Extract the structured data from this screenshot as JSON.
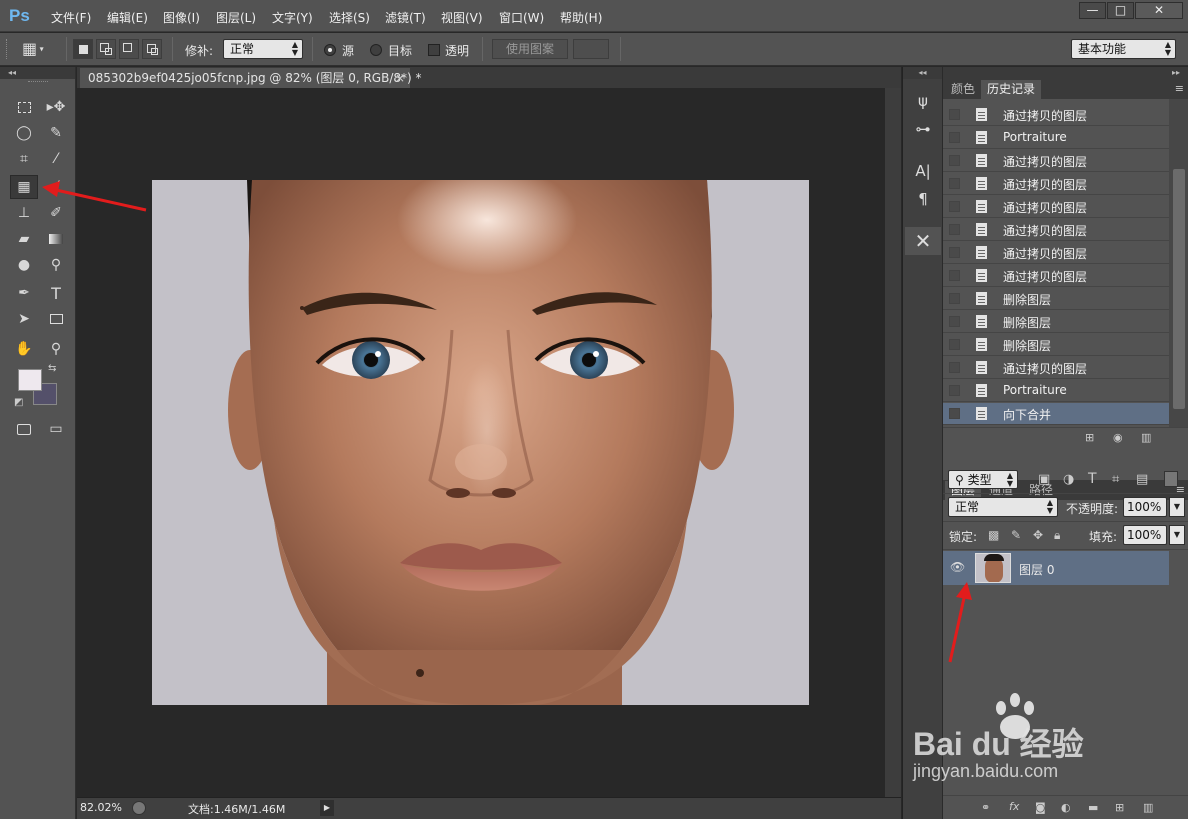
{
  "app": {
    "logo": "Ps"
  },
  "menu": [
    "文件(F)",
    "编辑(E)",
    "图像(I)",
    "图层(L)",
    "文字(Y)",
    "选择(S)",
    "滤镜(T)",
    "视图(V)",
    "窗口(W)",
    "帮助(H)"
  ],
  "window_controls": {
    "minimize": "—",
    "maximize": "□",
    "close": "✕"
  },
  "options": {
    "patch_label": "修补:",
    "patch_mode": "正常",
    "source_label": "源",
    "target_label": "目标",
    "transparent_label": "透明",
    "use_pattern": "使用图案",
    "workspace": "基本功能",
    "source_selected": true
  },
  "document": {
    "tab_title": "085302b9ef0425jo05fcnp.jpg @ 82% (图层 0, RGB/8*) *",
    "tab_close": "×",
    "zoom": "82.02%",
    "doc_size": "文档:1.46M/1.46M"
  },
  "colors": {
    "foreground": "#eee8ee",
    "background": "#54506a",
    "selection": "#5f6f85"
  },
  "history_panel": {
    "tabs": [
      "颜色",
      "历史记录"
    ],
    "active_tab": "历史记录",
    "items": [
      "通过拷贝的图层",
      "Portraiture",
      "通过拷贝的图层",
      "通过拷贝的图层",
      "通过拷贝的图层",
      "通过拷贝的图层",
      "通过拷贝的图层",
      "通过拷贝的图层",
      "删除图层",
      "删除图层",
      "删除图层",
      "通过拷贝的图层",
      "Portraiture",
      "向下合并"
    ],
    "selected_index": 13
  },
  "layers_panel": {
    "tabs": [
      "图层",
      "通道",
      "路径"
    ],
    "active_tab": "图层",
    "filter_kind": "类型",
    "blend_mode": "正常",
    "opacity_label": "不透明度:",
    "opacity": "100%",
    "lock_label": "锁定:",
    "fill_label": "填充:",
    "fill": "100%",
    "layers": [
      {
        "name": "图层 0",
        "visible": true,
        "selected": true
      }
    ]
  },
  "watermark": {
    "brand": "Bai du 经验",
    "url": "jingyan.baidu.com"
  }
}
